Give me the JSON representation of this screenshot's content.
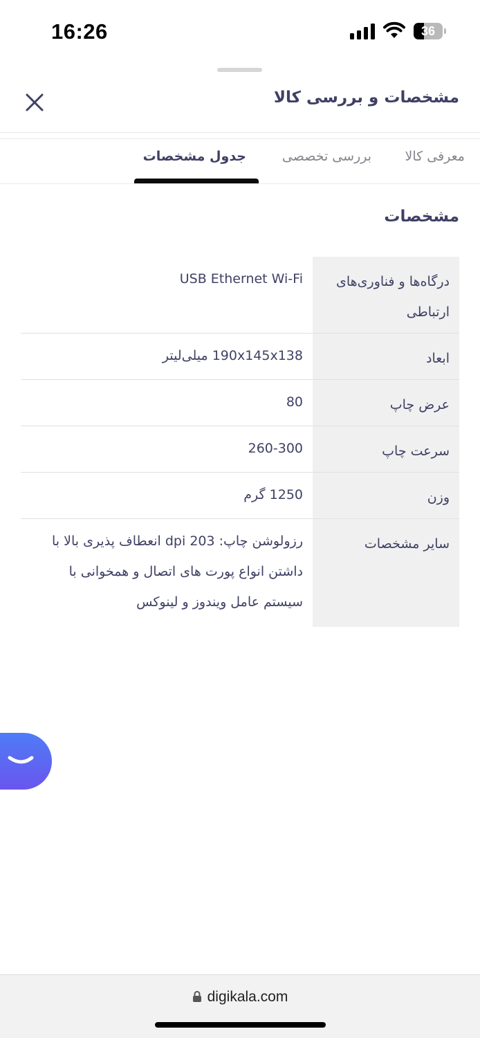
{
  "status_bar": {
    "time": "16:26",
    "battery_level": "36",
    "battery_percent": 36,
    "icons": [
      "cellular-signal-icon",
      "wifi-icon",
      "battery-icon"
    ]
  },
  "header": {
    "title": "مشخصات و بررسی کالا",
    "close_icon": "close-icon"
  },
  "tabs": [
    {
      "label": "معرفی کالا",
      "active": false
    },
    {
      "label": "بررسی تخصصی",
      "active": false
    },
    {
      "label": "جدول مشخصات",
      "active": true
    }
  ],
  "section_title": "مشخصات",
  "specs": [
    {
      "label": "درگاه‌ها و فناوری‌های ارتباطی",
      "value": "USB Ethernet Wi-Fi"
    },
    {
      "label": "ابعاد",
      "value": "190x145x138 میلی‌لیتر"
    },
    {
      "label": "عرض چاپ",
      "value": "80"
    },
    {
      "label": "سرعت چاپ",
      "value": "260-300"
    },
    {
      "label": "وزن",
      "value": "1250 گرم"
    },
    {
      "label": "سایر مشخصات",
      "value": "رزولوشن چاپ: 203 dpi انعطاف پذیری بالا با داشتن انواع پورت های اتصال و همخوانی با سیستم عامل ویندوز و لینوکس"
    }
  ],
  "chat_button": {
    "icon": "smile-chat-icon"
  },
  "browser": {
    "url": "digikala.com",
    "lock_icon": "lock-icon"
  },
  "colors": {
    "text_primary": "#3f4064",
    "text_muted": "#81858b",
    "label_bg": "#f0f0f1",
    "tab_indicator": "#0c0c0c",
    "chat_gradient_top": "#4e7cf6",
    "chat_gradient_bottom": "#6a55ee"
  }
}
